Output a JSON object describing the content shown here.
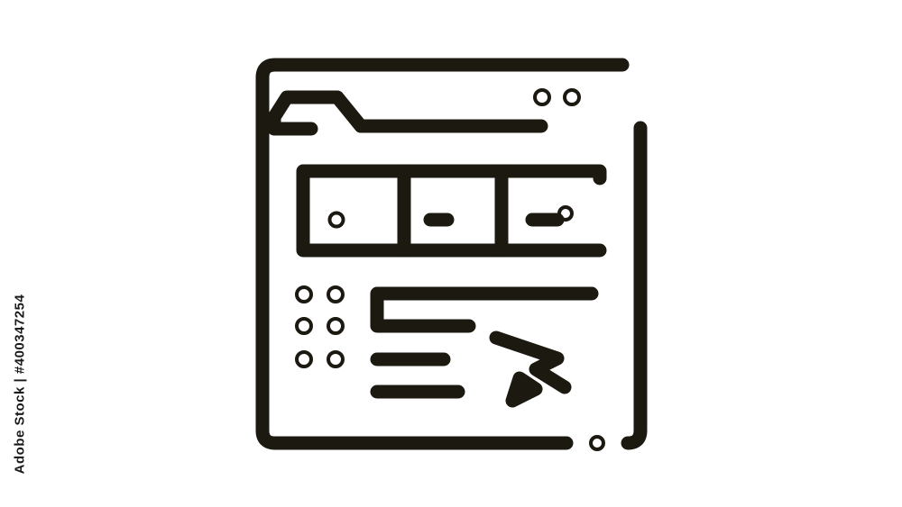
{
  "icon": {
    "name": "web-browser-folder-cursor-icon",
    "stroke_color": "#1c1911",
    "background_color": "#ffffff"
  },
  "watermark": {
    "stock_id": "Adobe Stock | #400347254"
  }
}
